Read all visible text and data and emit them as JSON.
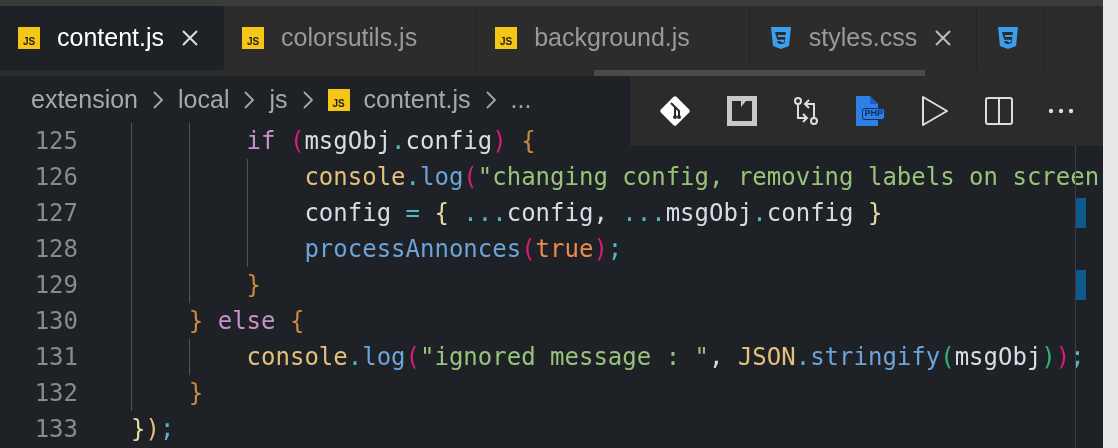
{
  "tabs": [
    {
      "label": "content.js",
      "kind": "js",
      "icon_text": "JS",
      "selected": true,
      "close_visible": true
    },
    {
      "label": "colorsutils.js",
      "kind": "js",
      "icon_text": "JS",
      "selected": false,
      "close_visible": false
    },
    {
      "label": "background.js",
      "kind": "js",
      "icon_text": "JS",
      "selected": false,
      "close_visible": false
    },
    {
      "label": "styles.css",
      "kind": "css",
      "selected": false,
      "close_visible": true
    },
    {
      "kind": "css",
      "selected": false
    }
  ],
  "breadcrumbs": [
    {
      "label": "extension"
    },
    {
      "label": "local"
    },
    {
      "label": "js"
    },
    {
      "label": "content.js",
      "icon_text": "JS"
    },
    {
      "label": "..."
    }
  ],
  "toolbar": [
    {
      "kind": "git"
    },
    {
      "kind": "preview"
    },
    {
      "kind": "compare"
    },
    {
      "kind": "php",
      "text": "PHP"
    },
    {
      "kind": "run"
    },
    {
      "kind": "split"
    },
    {
      "kind": "more"
    }
  ],
  "lines": [
    {
      "number": "125",
      "ruler_mark": false,
      "tokens": [
        {
          "text": "        if",
          "kind": "kw"
        },
        {
          "text": " (",
          "kind": "p1"
        },
        {
          "text": "msgObj",
          "kind": "plain"
        },
        {
          "text": ".",
          "kind": "punct"
        },
        {
          "text": "config",
          "kind": "plain"
        },
        {
          "text": ")",
          "kind": "p1"
        },
        {
          "text": " {",
          "kind": "b3"
        }
      ]
    },
    {
      "number": "126",
      "ruler_mark": false,
      "tokens": [
        {
          "text": "            console",
          "kind": "obj"
        },
        {
          "text": ".",
          "kind": "punct"
        },
        {
          "text": "log",
          "kind": "fn"
        },
        {
          "text": "(",
          "kind": "p1"
        },
        {
          "text": "\"changing config, removing labels on screen",
          "kind": "str"
        }
      ]
    },
    {
      "number": "127",
      "ruler_mark": true,
      "tokens": [
        {
          "text": "            config",
          "kind": "plain"
        },
        {
          "text": " =",
          "kind": "punct"
        },
        {
          "text": " {",
          "kind": "b4"
        },
        {
          "text": " ...",
          "kind": "punct"
        },
        {
          "text": "config, ",
          "kind": "plain"
        },
        {
          "text": "...",
          "kind": "punct"
        },
        {
          "text": "msgObj",
          "kind": "plain"
        },
        {
          "text": ".",
          "kind": "punct"
        },
        {
          "text": "config ",
          "kind": "plain"
        },
        {
          "text": "}",
          "kind": "b4"
        }
      ]
    },
    {
      "number": "128",
      "ruler_mark": false,
      "tokens": [
        {
          "text": "            processAnnonces",
          "kind": "fn"
        },
        {
          "text": "(",
          "kind": "p1"
        },
        {
          "text": "true",
          "kind": "bool"
        },
        {
          "text": ")",
          "kind": "p1"
        },
        {
          "text": ";",
          "kind": "punct"
        }
      ]
    },
    {
      "number": "129",
      "ruler_mark": true,
      "tokens": [
        {
          "text": "        }",
          "kind": "b3"
        }
      ]
    },
    {
      "number": "130",
      "ruler_mark": false,
      "tokens": [
        {
          "text": "    }",
          "kind": "b3"
        },
        {
          "text": " else",
          "kind": "kw"
        },
        {
          "text": " {",
          "kind": "b3"
        }
      ]
    },
    {
      "number": "131",
      "ruler_mark": false,
      "tokens": [
        {
          "text": "        console",
          "kind": "obj"
        },
        {
          "text": ".",
          "kind": "punct"
        },
        {
          "text": "log",
          "kind": "fn"
        },
        {
          "text": "(",
          "kind": "p1"
        },
        {
          "text": "\"ignored message : \"",
          "kind": "str"
        },
        {
          "text": ", ",
          "kind": "plain"
        },
        {
          "text": "JSON",
          "kind": "obj"
        },
        {
          "text": ".",
          "kind": "punct"
        },
        {
          "text": "stringify",
          "kind": "fn"
        },
        {
          "text": "(",
          "kind": "p2"
        },
        {
          "text": "msgObj",
          "kind": "plain"
        },
        {
          "text": ")",
          "kind": "p2"
        },
        {
          "text": ")",
          "kind": "p1"
        },
        {
          "text": ";",
          "kind": "punct"
        }
      ]
    },
    {
      "number": "132",
      "ruler_mark": false,
      "tokens": [
        {
          "text": "    }",
          "kind": "b3"
        }
      ]
    },
    {
      "number": "133",
      "ruler_mark": false,
      "tokens": [
        {
          "text": "}",
          "kind": "b4"
        },
        {
          "text": ")",
          "kind": "obj"
        },
        {
          "text": ";",
          "kind": "punct"
        }
      ]
    }
  ]
}
